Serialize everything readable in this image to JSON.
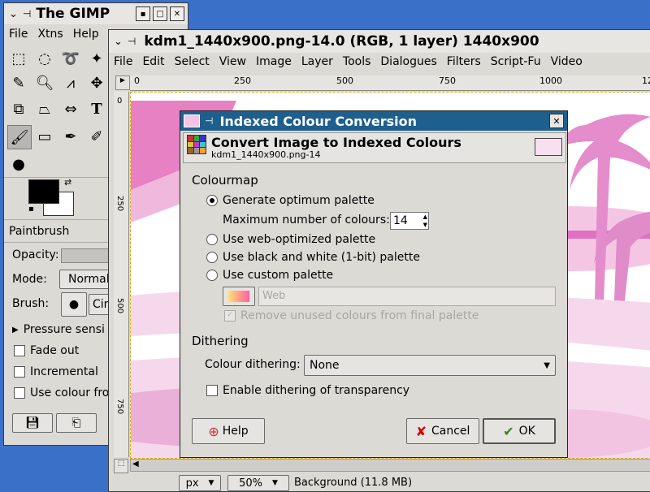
{
  "toolbox": {
    "title": "The GIMP",
    "menu": [
      "File",
      "Xtns",
      "Help"
    ],
    "tool_options_title": "Paintbrush",
    "opacity_label": "Opacity:",
    "mode_label": "Mode:",
    "mode_value": "Normal",
    "brush_label": "Brush:",
    "brush_value": "Circ",
    "pressure_label": "Pressure sensi",
    "fade_out_label": "Fade out",
    "incremental_label": "Incremental",
    "use_colour_label": "Use colour fro"
  },
  "image_window": {
    "title": "kdm1_1440x900.png-14.0 (RGB, 1 layer) 1440x900",
    "menu": [
      "File",
      "Edit",
      "Select",
      "View",
      "Image",
      "Layer",
      "Tools",
      "Dialogues",
      "Filters",
      "Script-Fu",
      "Video"
    ],
    "ruler_labels": [
      "0",
      "250",
      "500",
      "750",
      "1000",
      "12"
    ],
    "vruler_labels": [
      "0",
      "250",
      "500",
      "750"
    ],
    "status_unit": "px",
    "status_zoom": "50%",
    "status_text": "Background (11.8 MB)"
  },
  "dialog": {
    "title": "Indexed Colour Conversion",
    "header_title": "Convert Image to Indexed Colours",
    "header_subtitle": "kdm1_1440x900.png-14",
    "colourmap_heading": "Colourmap",
    "opt_generate": "Generate optimum palette",
    "max_colours_label": "Maximum number of colours:",
    "max_colours_value": "14",
    "opt_web": "Use web-optimized palette",
    "opt_bw": "Use black and white (1-bit) palette",
    "opt_custom": "Use custom palette",
    "custom_palette_name": "Web",
    "remove_unused_label": "Remove unused colours from final palette",
    "dithering_heading": "Dithering",
    "colour_dithering_label": "Colour dithering:",
    "colour_dithering_value": "None",
    "transparency_label": "Enable dithering of transparency",
    "help_label": "Help",
    "cancel_label": "Cancel",
    "ok_label": "OK"
  },
  "colors": {
    "desktop": "#3a70c8",
    "dialog_title_bg": "#1f5f8e",
    "canvas_pink": "#e88ac8"
  }
}
